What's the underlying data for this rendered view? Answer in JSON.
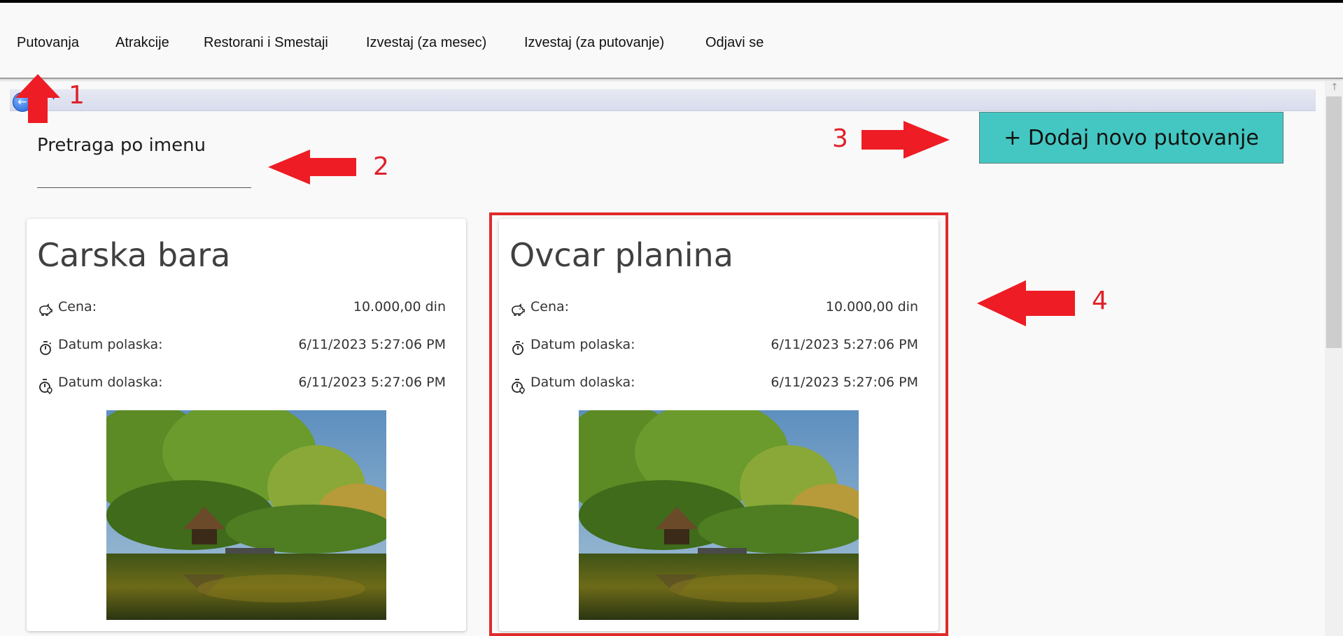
{
  "menu": {
    "items": [
      {
        "label": "Putovanja"
      },
      {
        "label": "Atrakcije"
      },
      {
        "label": "Restorani i Smestaji"
      },
      {
        "label": "Izvestaj (za mesec)"
      },
      {
        "label": "Izvestaj (za putovanje)"
      },
      {
        "label": "Odjavi se"
      }
    ]
  },
  "search": {
    "label": "Pretraga po imenu",
    "value": "",
    "placeholder": ""
  },
  "add_button": {
    "label": "+ Dodaj novo putovanje"
  },
  "cards": [
    {
      "title": "Carska bara",
      "rows": [
        {
          "icon": "piggy-bank-icon",
          "label": "Cena:",
          "value": "10.000,00 din"
        },
        {
          "icon": "timer-icon",
          "label": "Datum polaska:",
          "value": "6/11/2023 5:27:06 PM"
        },
        {
          "icon": "timer-location-icon",
          "label": "Datum dolaska:",
          "value": "6/11/2023 5:27:06 PM"
        }
      ]
    },
    {
      "title": "Ovcar planina",
      "rows": [
        {
          "icon": "piggy-bank-icon",
          "label": "Cena:",
          "value": "10.000,00 din"
        },
        {
          "icon": "timer-icon",
          "label": "Datum polaska:",
          "value": "6/11/2023 5:27:06 PM"
        },
        {
          "icon": "timer-location-icon",
          "label": "Datum dolaska:",
          "value": "6/11/2023 5:27:06 PM"
        }
      ]
    }
  ],
  "annotations": {
    "n1": "1",
    "n2": "2",
    "n3": "3",
    "n4": "4"
  },
  "colors": {
    "accent": "#44c7c2",
    "annotation": "#e0202a",
    "highlight_border": "#e02a2a"
  }
}
